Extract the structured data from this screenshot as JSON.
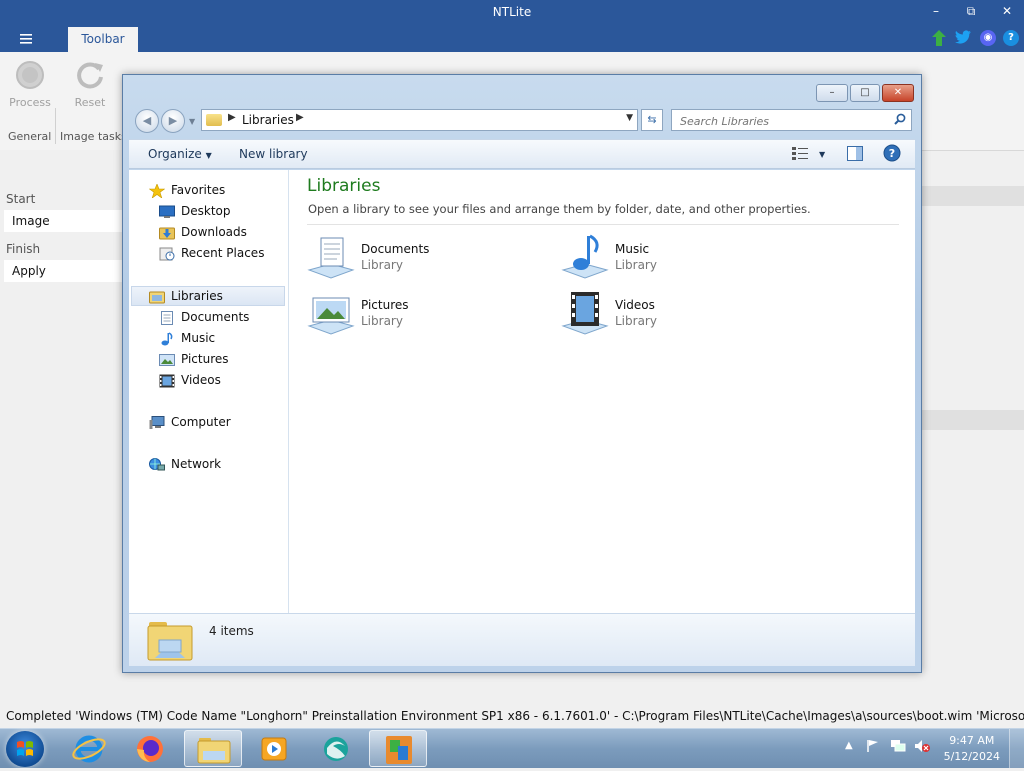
{
  "ntlite": {
    "title": "NTLite",
    "menu_icon": "hamburger-icon",
    "tab": "Toolbar",
    "window_controls": {
      "minimize": "–",
      "maximize": "⧉",
      "close": "✕"
    },
    "ribbon": {
      "process_label": "Process",
      "reset_label": "Reset",
      "group_general": "General",
      "group_image_tasks": "Image tasks"
    },
    "sidebar": {
      "start_head": "Start",
      "image_item": "Image",
      "finish_head": "Finish",
      "apply_item": "Apply"
    },
    "status_text": "Completed  'Windows (TM) Code Name \"Longhorn\" Preinstallation Environment SP1 x86 - 6.1.7601.0' - C:\\Program Files\\NTLite\\Cache\\Images\\a\\sources\\boot.wim 'Microsoft Window..."
  },
  "explorer": {
    "controls": {
      "minimize": "–",
      "maximize": "□",
      "close": "✕"
    },
    "address": {
      "crumb": "Libraries"
    },
    "search": {
      "placeholder": "Search Libraries"
    },
    "commands": {
      "organize": "Organize",
      "new_library": "New library"
    },
    "nav": {
      "favorites": "Favorites",
      "desktop": "Desktop",
      "downloads": "Downloads",
      "recent_places": "Recent Places",
      "libraries": "Libraries",
      "documents": "Documents",
      "music": "Music",
      "pictures": "Pictures",
      "videos": "Videos",
      "computer": "Computer",
      "network": "Network"
    },
    "content": {
      "title": "Libraries",
      "subtitle": "Open a library to see your files and arrange them by folder, date, and other properties.",
      "libraries": [
        {
          "name": "Documents",
          "type": "Library"
        },
        {
          "name": "Music",
          "type": "Library"
        },
        {
          "name": "Pictures",
          "type": "Library"
        },
        {
          "name": "Videos",
          "type": "Library"
        }
      ]
    },
    "details": {
      "count": "4 items"
    }
  },
  "taskbar": {
    "apps": [
      "internet-explorer-icon",
      "firefox-icon",
      "windows-explorer-icon",
      "media-player-icon",
      "browser-icon",
      "ntlite-icon"
    ],
    "time": "9:47 AM",
    "date": "5/12/2024"
  },
  "colors": {
    "ntlite_blue": "#2b579a",
    "library_title_green": "#1e7b1e",
    "close_red": "#c7442a"
  }
}
